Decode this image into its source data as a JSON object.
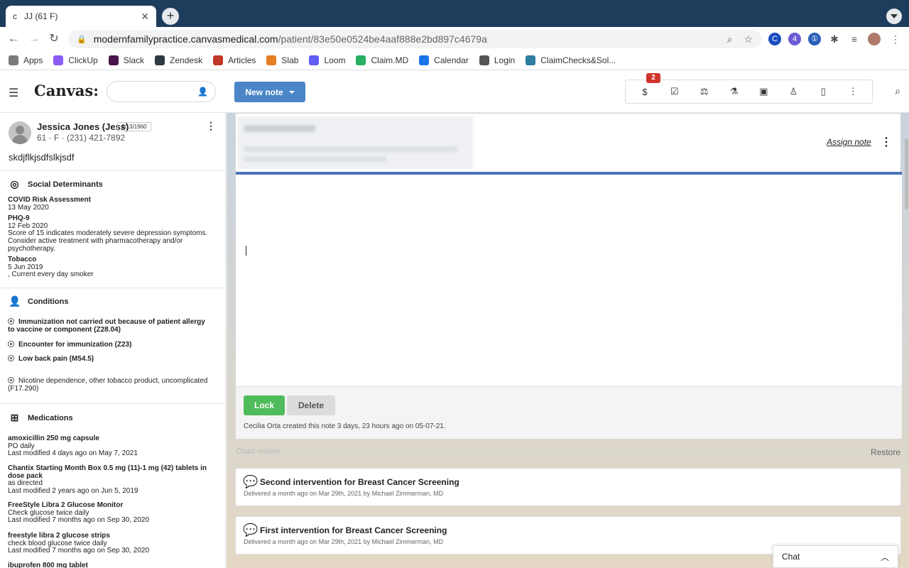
{
  "browser": {
    "tab_title": "JJ (61 F)",
    "tab_favicon": "c",
    "url_host": "modernfamilypractice.canvasmedical.com",
    "url_path": "/patient/83e50e0524be4aaf888e2bd897c4679a",
    "bookmarks": [
      {
        "label": "Apps",
        "color": "#7a7a7a"
      },
      {
        "label": "ClickUp",
        "color": "#8b5cf6"
      },
      {
        "label": "Slack",
        "color": "#4a154b"
      },
      {
        "label": "Zendesk",
        "color": "#2f3941"
      },
      {
        "label": "Articles",
        "color": "#c0392b"
      },
      {
        "label": "Slab",
        "color": "#e67e22"
      },
      {
        "label": "Loom",
        "color": "#625df5"
      },
      {
        "label": "Claim.MD",
        "color": "#27ae60"
      },
      {
        "label": "Calendar",
        "color": "#1a73e8"
      },
      {
        "label": "Login",
        "color": "#555555"
      },
      {
        "label": "ClaimChecks&Sol...",
        "color": "#2c7da0"
      }
    ],
    "ext_badges": {
      "first": "",
      "second": "4"
    }
  },
  "app": {
    "logo": "Canvas:",
    "search_value": "",
    "new_note_label": "New note",
    "badge_count": "2",
    "accent_color": "#4a86c8"
  },
  "patient": {
    "name": "Jessica Jones (Jess)",
    "dob": "2/13/1960",
    "info": "61 · F · (231) 421-7892",
    "note": "skdjflkjsdfslkjsdf"
  },
  "social": {
    "heading": "Social Determinants",
    "items": [
      {
        "title": "COVID Risk Assessment",
        "date": "13 May 2020",
        "text": ""
      },
      {
        "title": "PHQ-9",
        "date": "12 Feb 2020",
        "text": "Score of 15 indicates moderately severe depression symptoms. Consider active treatment with pharmacotherapy and/or psychotherapy."
      },
      {
        "title": "Tobacco",
        "date": "5 Jun 2019",
        "text": ", Current every day smoker"
      }
    ]
  },
  "conditions": {
    "heading": "Conditions",
    "items": [
      {
        "label": "Immunization not carried out because of patient allergy to vaccine or component (Z28.04)",
        "bold": true
      },
      {
        "label": "Encounter for immunization (Z23)",
        "bold": true
      },
      {
        "label": "Low back pain (M54.5)",
        "bold": true
      },
      {
        "label": "Nicotine dependence, other tobacco product, uncomplicated (F17.290)",
        "bold": false
      }
    ]
  },
  "medications": {
    "heading": "Medications",
    "items": [
      {
        "name": "amoxicillin 250 mg capsule",
        "sig": "PO daily",
        "modified": "Last modified 4 days ago on May 7, 2021"
      },
      {
        "name": "Chantix Starting Month Box 0.5 mg (11)-1 mg (42) tablets in dose pack",
        "sig": "as directed",
        "modified": "Last modified 2 years ago on Jun 5, 2019"
      },
      {
        "name": "FreeStyle Libra 2 Glucose Monitor",
        "sig": "Check glucose twice daily",
        "modified": "Last modified 7 months ago on Sep 30, 2020"
      },
      {
        "name": "freestyle libra 2 glucose strips",
        "sig": "check blood glucose twice daily",
        "modified": "Last modified 7 months ago on Sep 30, 2020"
      },
      {
        "name": "ibuprofen 800 mg tablet",
        "sig": "",
        "modified": ""
      }
    ]
  },
  "note": {
    "assign_label": "Assign note",
    "lock_label": "Lock",
    "delete_label": "Delete",
    "created_text": "Cecilia Orta created this note 3 days, 23 hours ago on 05-07-21."
  },
  "timeline": {
    "chart_review": "Chart review",
    "restore": "Restore",
    "interventions": [
      {
        "title": "Second intervention for Breast Cancer Screening",
        "sub": "Delivered a month ago on Mar 29th, 2021 by Michael Zimmerman, MD"
      },
      {
        "title": "First intervention for Breast Cancer Screening",
        "sub": "Delivered a month ago on Mar 29th, 2021 by Michael Zimmerman, MD"
      }
    ]
  },
  "chat": {
    "label": "Chat"
  }
}
